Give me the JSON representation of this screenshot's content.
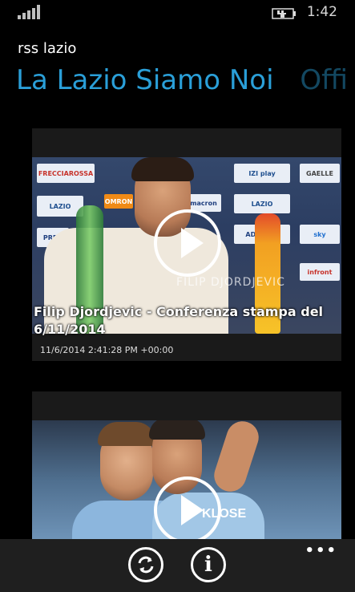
{
  "status": {
    "time": "1:42"
  },
  "app": {
    "title": "rss lazio"
  },
  "pivot": [
    {
      "label": "La Lazio Siamo Noi",
      "active": true
    },
    {
      "label": "Offi",
      "active": false
    }
  ],
  "feed": [
    {
      "title": "Filip Djordjevic - Conferenza stampa del 6/11/2014",
      "date": "11/6/2014 2:41:28 PM +00:00",
      "watermark": "FILIP DJORDJEVIC",
      "sponsors": [
        "FRECCIAROSSA",
        "IZI play",
        "GAELLE",
        "LAZIO",
        "OMRON",
        "macron",
        "LAZIO",
        "sky",
        "PREN",
        "ADMIRAL",
        "infront"
      ]
    },
    {
      "title": "",
      "date": "",
      "jersey_text": "KLOSE"
    }
  ],
  "appbar": {
    "buttons": [
      {
        "icon": "refresh-icon"
      },
      {
        "icon": "info-icon"
      }
    ],
    "more": "•••"
  },
  "colors": {
    "accent": "#2a9fd8",
    "background": "#000000",
    "appbar": "#1f1f1f"
  }
}
